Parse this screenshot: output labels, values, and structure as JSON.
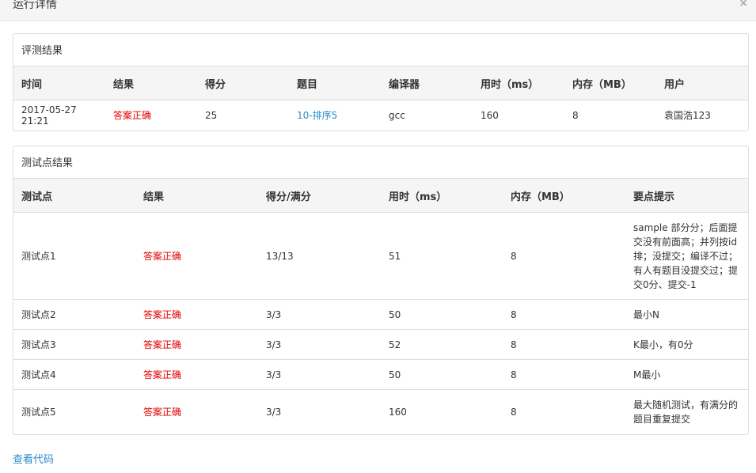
{
  "modal": {
    "title": "运行详情",
    "close_symbol": "×"
  },
  "judge": {
    "title": "评测结果",
    "columns": [
      "时间",
      "结果",
      "得分",
      "题目",
      "编译器",
      "用时（ms）",
      "内存（MB）",
      "用户"
    ],
    "row": [
      "2017-05-27 21:21",
      "答案正确",
      "25",
      "10-排序5",
      "gcc",
      "160",
      "8",
      "袁国浩123"
    ]
  },
  "tests": {
    "title": "测试点结果",
    "columns": [
      "测试点",
      "结果",
      "得分/满分",
      "用时（ms）",
      "内存（MB）",
      "要点提示"
    ],
    "rows": [
      [
        "测试点1",
        "答案正确",
        "13/13",
        "51",
        "8",
        "sample 部分分；后面提交没有前面高；并列按id排；没提交；编译不过；有人有题目没提交过；提交0分、提交-1"
      ],
      [
        "测试点2",
        "答案正确",
        "3/3",
        "50",
        "8",
        "最小N"
      ],
      [
        "测试点3",
        "答案正确",
        "3/3",
        "52",
        "8",
        "K最小，有0分"
      ],
      [
        "测试点4",
        "答案正确",
        "3/3",
        "50",
        "8",
        "M最小"
      ],
      [
        "测试点5",
        "答案正确",
        "3/3",
        "160",
        "8",
        "最大随机测试，有满分的题目重复提交"
      ]
    ]
  },
  "view_code": "查看代码",
  "colors": {
    "correct": "#e10000",
    "link": "#2a8bcc"
  }
}
